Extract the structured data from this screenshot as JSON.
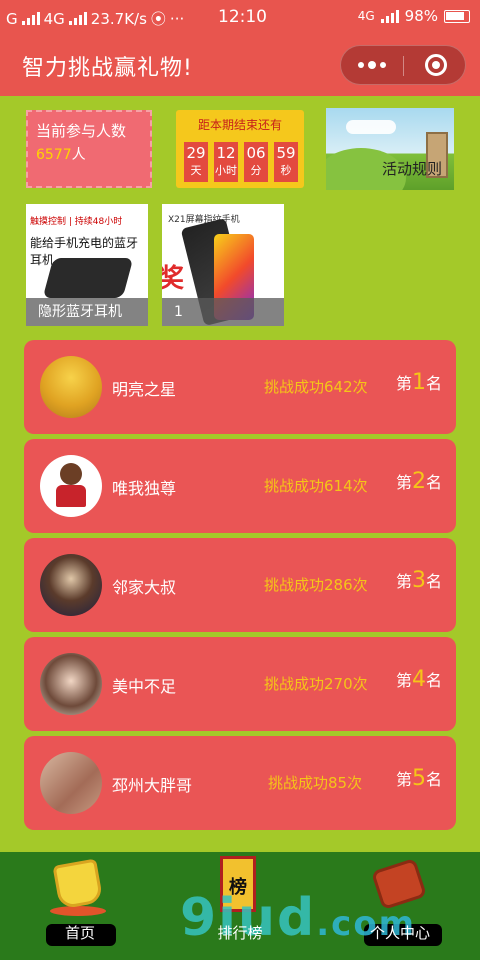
{
  "status_bar": {
    "carrier": "G",
    "network": "4G",
    "speed": "23.7K/s",
    "time": "12:10",
    "network_right": "4G",
    "battery": "98%"
  },
  "header": {
    "title": "智力挑战赢礼物!"
  },
  "participants": {
    "label": "当前参与人数",
    "count": "6577",
    "unit": "人"
  },
  "countdown": {
    "title": "距本期结束还有",
    "days": "29",
    "days_unit": "天",
    "hours": "12",
    "hours_unit": "小时",
    "minutes": "06",
    "minutes_unit": "分",
    "seconds": "59",
    "seconds_unit": "秒"
  },
  "rules": {
    "label": "活动规则"
  },
  "prizes": [
    {
      "caption": "隐形蓝牙耳机",
      "tag": "触摸控制 | 持续48小时",
      "headline": "能给手机充电的蓝牙耳机"
    },
    {
      "caption": "1",
      "brand": "X21屏幕指纹手机",
      "overlay": "奖"
    }
  ],
  "ranking": [
    {
      "name": "明亮之星",
      "score": "挑战成功642次",
      "rank_prefix": "第",
      "rank": "1",
      "rank_suffix": "名"
    },
    {
      "name": "唯我独尊",
      "score": "挑战成功614次",
      "rank_prefix": "第",
      "rank": "2",
      "rank_suffix": "名"
    },
    {
      "name": "邻家大叔",
      "score": "挑战成功286次",
      "rank_prefix": "第",
      "rank": "3",
      "rank_suffix": "名"
    },
    {
      "name": "美中不足",
      "score": "挑战成功270次",
      "rank_prefix": "第",
      "rank": "4",
      "rank_suffix": "名"
    },
    {
      "name": "邳州大胖哥",
      "score": "挑战成功85次",
      "rank_prefix": "第",
      "rank": "5",
      "rank_suffix": "名"
    }
  ],
  "tabs": [
    {
      "label": "首页",
      "icon": "trophy-icon"
    },
    {
      "label": "排行榜",
      "icon": "ranking-scroll-icon",
      "icon_text": "榜"
    },
    {
      "label": "个人中心",
      "icon": "book-icon"
    }
  ],
  "watermark": {
    "main": "9iud",
    "suffix": ".com"
  }
}
